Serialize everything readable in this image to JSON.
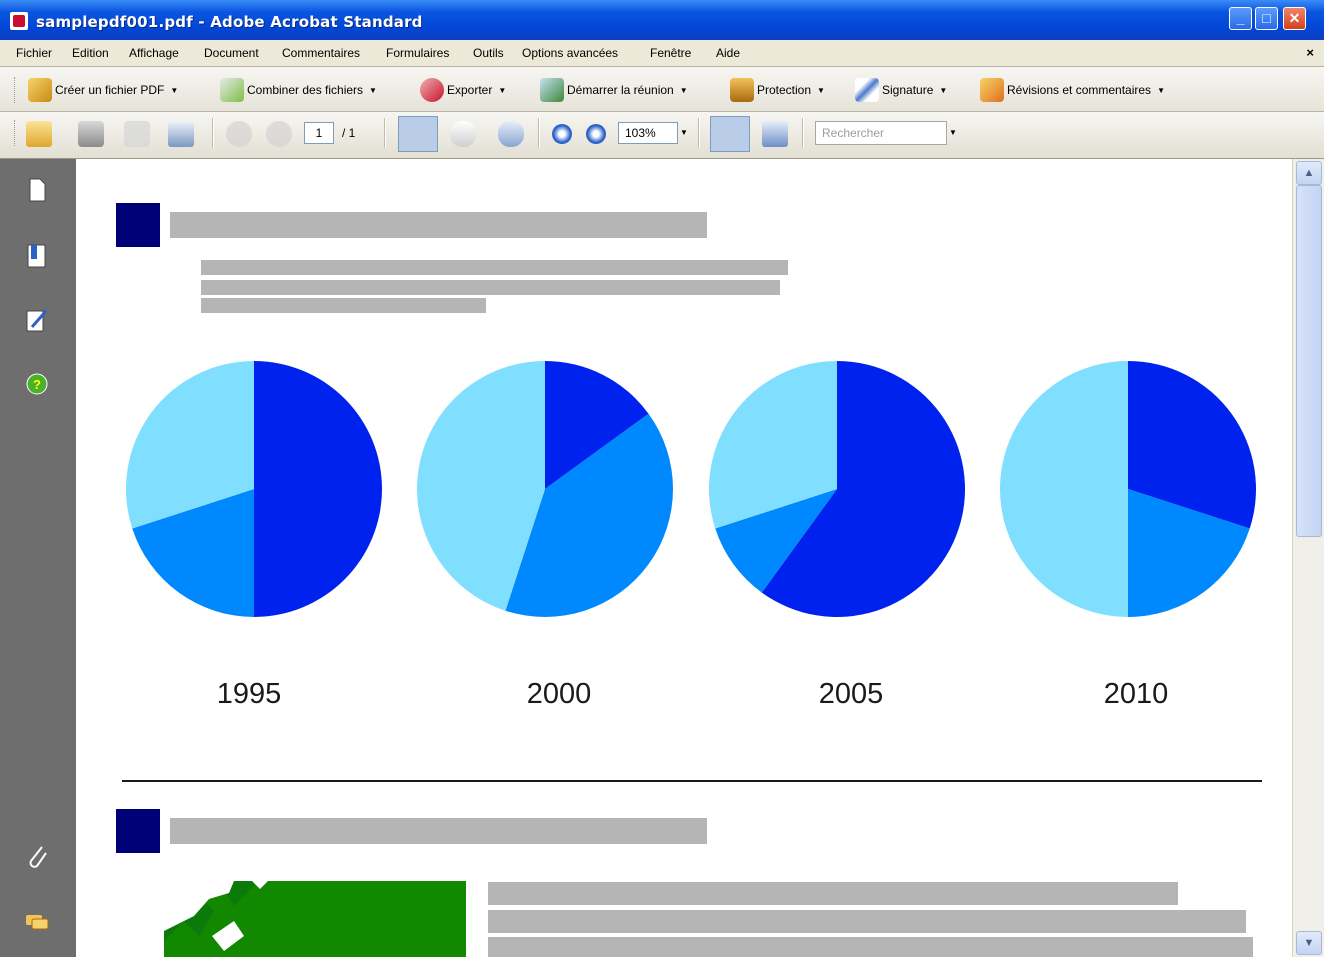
{
  "window": {
    "title": "samplepdf001.pdf - Adobe Acrobat Standard",
    "colors": {
      "titlebar": "#0a55e0",
      "accent_dark": "#000077"
    }
  },
  "menubar": {
    "items": [
      "Fichier",
      "Edition",
      "Affichage",
      "Document",
      "Commentaires",
      "Formulaires",
      "Outils",
      "Options avancées",
      "Fenêtre",
      "Aide"
    ],
    "close": "×"
  },
  "toolbar1": {
    "buttons": [
      {
        "label": "Créer un fichier PDF",
        "icon": "create-pdf-icon"
      },
      {
        "label": "Combiner des fichiers",
        "icon": "combine-files-icon"
      },
      {
        "label": "Exporter",
        "icon": "export-icon"
      },
      {
        "label": "Démarrer la réunion",
        "icon": "meeting-icon"
      },
      {
        "label": "Protection",
        "icon": "lock-icon"
      },
      {
        "label": "Signature",
        "icon": "pen-icon"
      },
      {
        "label": "Révisions et commentaires",
        "icon": "review-icon"
      }
    ],
    "dropdown_glyph": "▼"
  },
  "toolbar2": {
    "page_current": "1",
    "page_total": "/ 1",
    "zoom": "103%",
    "search_placeholder": "Rechercher",
    "dropdown_glyph": "▼"
  },
  "document": {
    "years": [
      "1995",
      "2000",
      "2005",
      "2010"
    ],
    "colors": {
      "dark_blue": "#0022ee",
      "mid_blue": "#0088ff",
      "light_blue": "#80dfff",
      "title_square": "#000077",
      "placeholder_bar": "#b5b5b5",
      "map_green": "#118800"
    }
  },
  "chart_data": {
    "type": "pie",
    "charts": [
      {
        "year": "1995",
        "values": [
          50,
          20,
          30
        ]
      },
      {
        "year": "2000",
        "values": [
          15,
          40,
          45
        ]
      },
      {
        "year": "2005",
        "values": [
          60,
          10,
          30
        ]
      },
      {
        "year": "2010",
        "values": [
          30,
          20,
          50
        ]
      }
    ],
    "colors": [
      "#0022ee",
      "#0088ff",
      "#80dfff"
    ]
  }
}
